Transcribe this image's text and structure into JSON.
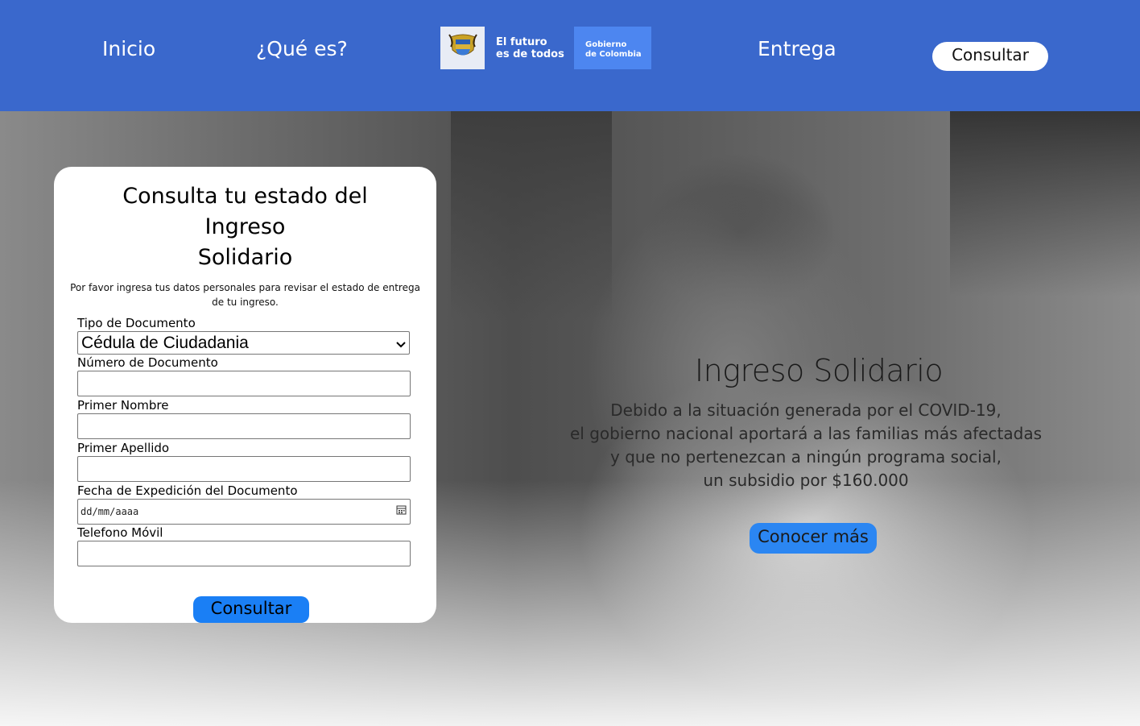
{
  "nav": {
    "inicio": "Inicio",
    "que_es": "¿Qué es?",
    "entrega": "Entrega",
    "consultar": "Consultar"
  },
  "logo": {
    "line1": "El futuro",
    "line2": "es de todos",
    "gov_line1": "Gobierno",
    "gov_line2": "de Colombia"
  },
  "form": {
    "title_line1": "Consulta tu estado del",
    "title_line2": "Ingreso",
    "title_line3": "Solidario",
    "subtitle": "Por favor ingresa tus datos personales para revisar el estado de entrega de tu ingreso.",
    "doc_type_label": "Tipo de Documento",
    "doc_type_value": "Cédula de Ciudadania",
    "doc_number_label": "Número de Documento",
    "first_name_label": "Primer Nombre",
    "last_name_label": "Primer Apellido",
    "issue_date_label": "Fecha de Expedición del Documento",
    "issue_date_placeholder": "dd/mm/aaaa",
    "phone_label": "Telefono Móvil",
    "submit": "Consultar"
  },
  "hero": {
    "title": "Ingreso Solidario",
    "desc_line1": "Debido a la situación generada por el COVID-19,",
    "desc_line2": "el gobierno nacional aportará a las familias más afectadas",
    "desc_line3": "y que no pertenezcan a ningún programa social,",
    "desc_line4": "un subsidio por $160.000",
    "button": "Conocer más"
  },
  "colors": {
    "header_bg": "#3a68cc",
    "primary_button": "#1a7ff5",
    "hero_button": "#2b86f2"
  }
}
